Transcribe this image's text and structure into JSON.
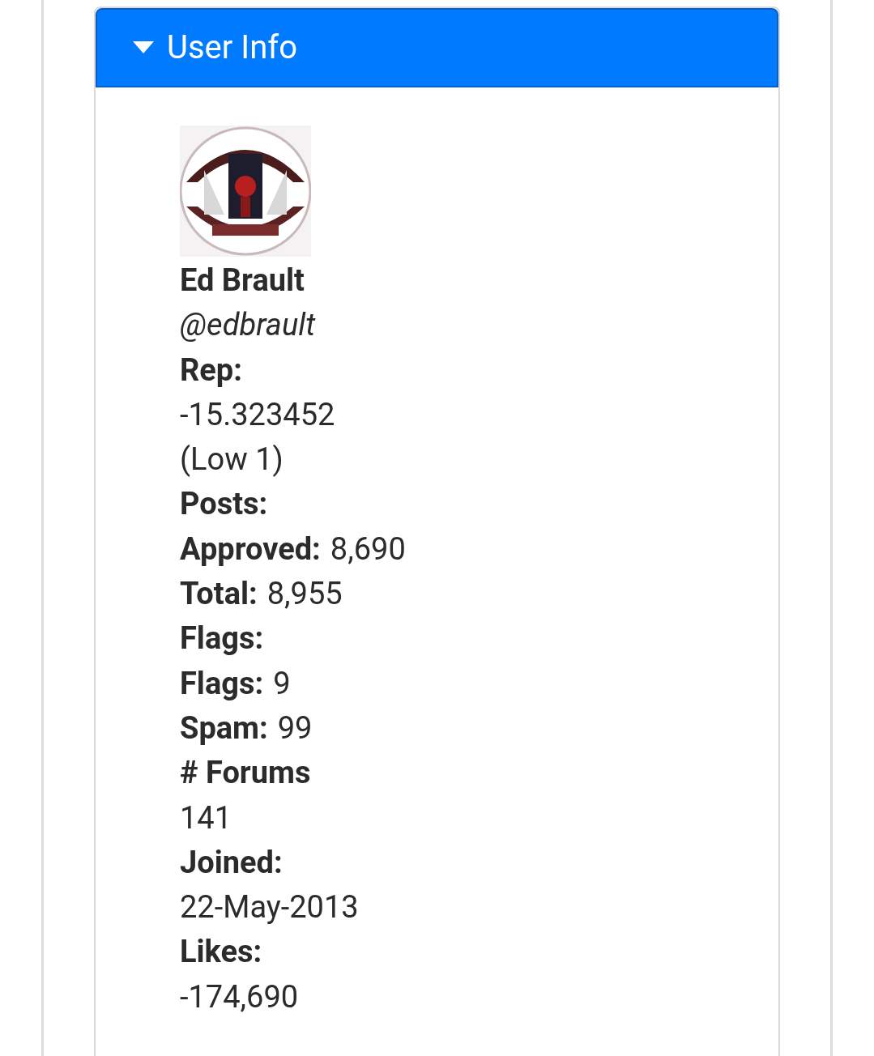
{
  "panel": {
    "title": "User Info",
    "expanded": true
  },
  "user": {
    "name": "Ed Brault",
    "handle": "@edbrault"
  },
  "fields": [
    {
      "kind": "heading",
      "label": "Rep:"
    },
    {
      "kind": "value",
      "value": "-15.323452"
    },
    {
      "kind": "value",
      "value": "(Low 1)"
    },
    {
      "kind": "heading",
      "label": "Posts:"
    },
    {
      "kind": "pair",
      "label": "Approved:",
      "value": "8,690"
    },
    {
      "kind": "pair",
      "label": "Total:",
      "value": "8,955"
    },
    {
      "kind": "heading",
      "label": "Flags:"
    },
    {
      "kind": "pair",
      "label": "Flags:",
      "value": "9"
    },
    {
      "kind": "pair",
      "label": "Spam:",
      "value": "99"
    },
    {
      "kind": "heading",
      "label": "# Forums"
    },
    {
      "kind": "value",
      "value": "141"
    },
    {
      "kind": "heading",
      "label": "Joined:"
    },
    {
      "kind": "value",
      "value": "22-May-2013"
    },
    {
      "kind": "heading",
      "label": "Likes:"
    },
    {
      "kind": "value",
      "value": "-174,690"
    }
  ]
}
